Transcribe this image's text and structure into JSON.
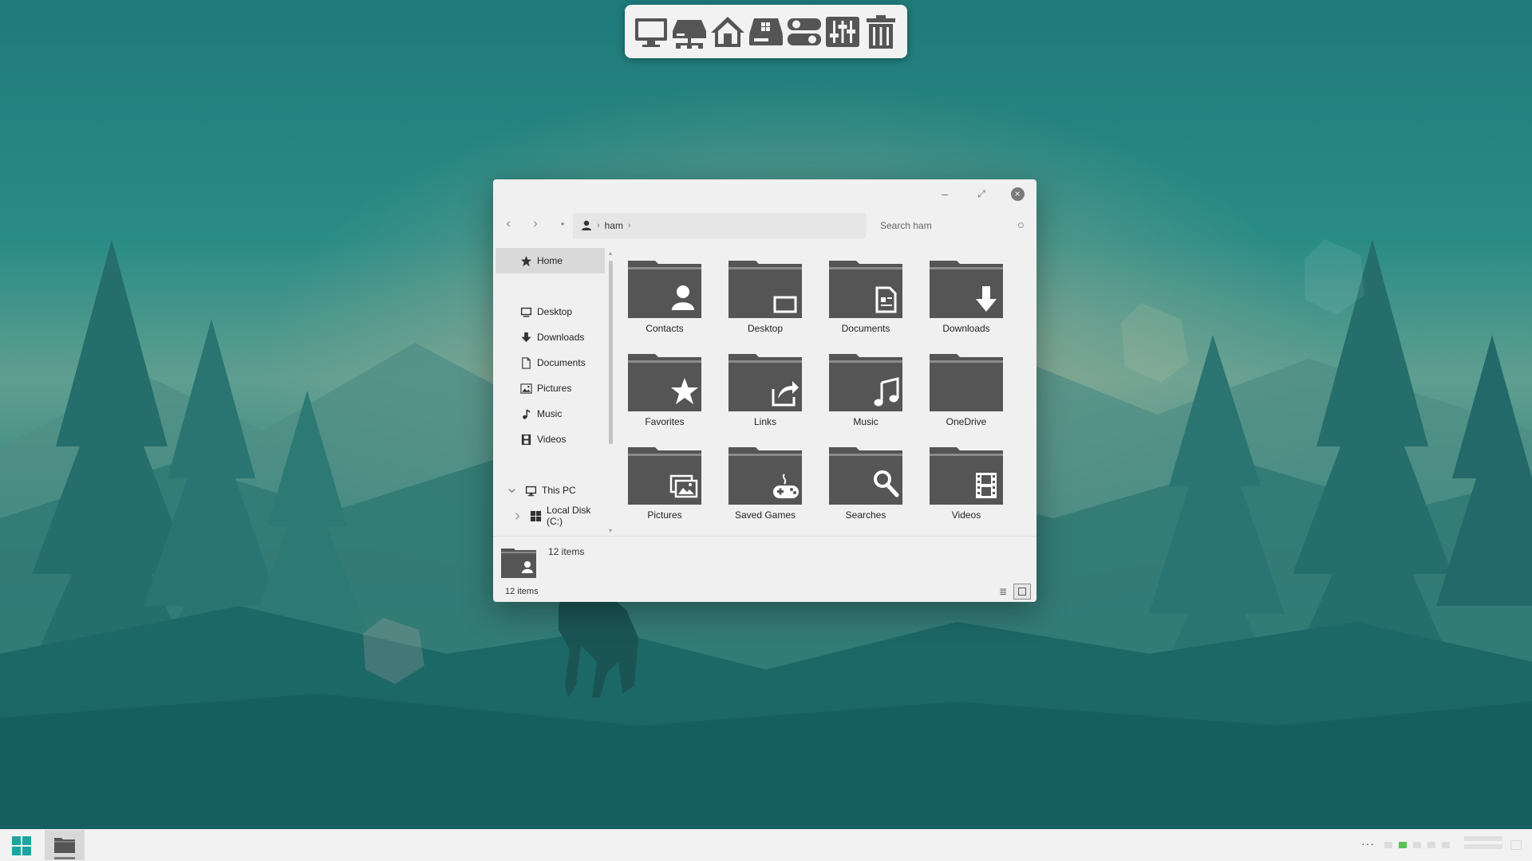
{
  "dock": {
    "items": [
      {
        "icon": "monitor-icon"
      },
      {
        "icon": "network-icon"
      },
      {
        "icon": "home-icon"
      },
      {
        "icon": "drive-icon"
      },
      {
        "icon": "control-panel-icon"
      },
      {
        "icon": "mixer-icon"
      },
      {
        "icon": "trash-icon"
      }
    ]
  },
  "window": {
    "titlebar": {
      "minimize_icon": "minimize-icon",
      "maximize_icon": "maximize-icon",
      "close_icon": "close-icon"
    },
    "navigation": {
      "back_icon": "back-icon",
      "forward_icon": "forward-icon",
      "up_icon": "up-icon",
      "address": {
        "user_icon": "user-icon",
        "path": "ham"
      },
      "search": {
        "placeholder": "Search ham"
      }
    },
    "sidebar": {
      "items": [
        {
          "label": "Home",
          "icon": "star-icon",
          "active": true
        },
        {
          "label": "Desktop",
          "icon": "desktop-icon"
        },
        {
          "label": "Downloads",
          "icon": "download-icon"
        },
        {
          "label": "Documents",
          "icon": "document-icon"
        },
        {
          "label": "Pictures",
          "icon": "pictures-icon"
        },
        {
          "label": "Music",
          "icon": "music-icon"
        },
        {
          "label": "Videos",
          "icon": "videos-icon"
        },
        {
          "label": "This PC",
          "icon": "computer-icon",
          "expanded": true
        },
        {
          "label": "Local Disk (C:)",
          "icon": "windows-drive-icon",
          "expanded": false
        }
      ]
    },
    "folders": [
      {
        "label": "Contacts",
        "icon": "contacts-folder-icon"
      },
      {
        "label": "Desktop",
        "icon": "desktop-folder-icon"
      },
      {
        "label": "Documents",
        "icon": "documents-folder-icon"
      },
      {
        "label": "Downloads",
        "icon": "downloads-folder-icon"
      },
      {
        "label": "Favorites",
        "icon": "favorites-folder-icon"
      },
      {
        "label": "Links",
        "icon": "links-folder-icon"
      },
      {
        "label": "Music",
        "icon": "music-folder-icon"
      },
      {
        "label": "OneDrive",
        "icon": "onedrive-folder-icon"
      },
      {
        "label": "Pictures",
        "icon": "pictures-folder-icon"
      },
      {
        "label": "Saved Games",
        "icon": "saved-games-folder-icon"
      },
      {
        "label": "Searches",
        "icon": "searches-folder-icon"
      },
      {
        "label": "Videos",
        "icon": "videos-folder-icon"
      }
    ],
    "details": {
      "item_count": "12 items"
    },
    "status_bar": {
      "item_count": "12 items"
    }
  },
  "taskbar": {
    "start_icon": "windows-start-icon",
    "apps": [
      {
        "icon": "file-explorer-icon",
        "active": true
      }
    ],
    "tray_overflow": "···"
  },
  "colors": {
    "accent": "#1aa6a0",
    "folder": "#555555",
    "window_bg": "#f0f0f0",
    "taskbar_bg": "#f2f2f2",
    "wallpaper_teal": "#1f7a7a"
  }
}
